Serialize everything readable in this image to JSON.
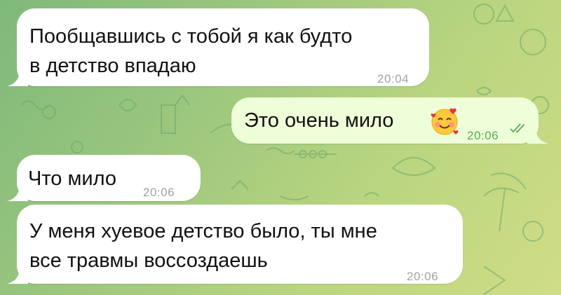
{
  "messages": [
    {
      "direction": "incoming",
      "lines": [
        "Пообщавшись с тобой я как будто",
        "в детство впадаю"
      ],
      "time": "20:04"
    },
    {
      "direction": "outgoing",
      "text": "Это очень мило",
      "emoji": "smiling-face-with-hearts",
      "time": "20:06",
      "status": "read"
    },
    {
      "direction": "incoming",
      "text": "Что мило",
      "time": "20:06"
    },
    {
      "direction": "incoming",
      "lines": [
        "У меня хуевое детство было, ты мне",
        "все травмы воссоздаешь"
      ],
      "time": "20:06"
    }
  ],
  "colors": {
    "incoming_bubble": "#ffffff",
    "outgoing_bubble": "#eefed9",
    "outgoing_meta": "#5aa85a",
    "incoming_meta": "#a3a3a3"
  }
}
